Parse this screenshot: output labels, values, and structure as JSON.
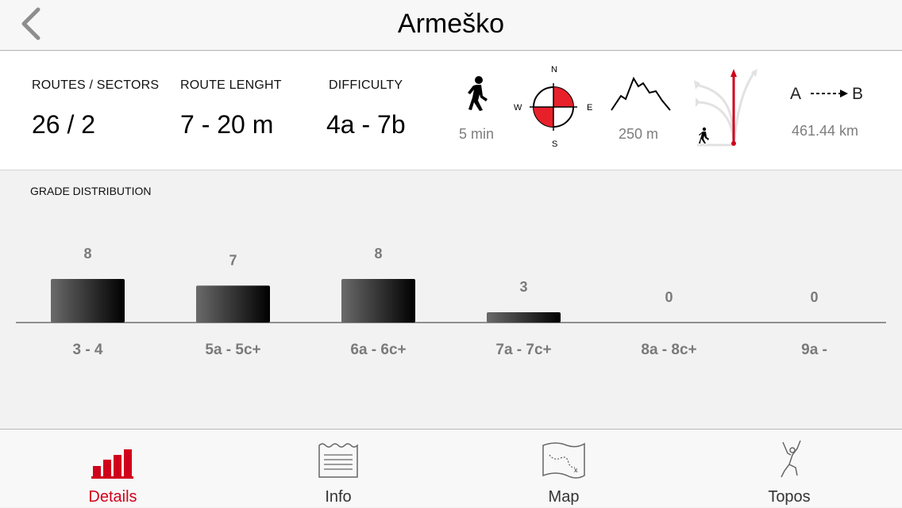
{
  "header": {
    "title": "Armeško"
  },
  "stats": {
    "routes_label": "ROUTES / SECTORS",
    "routes_value": "26 / 2",
    "length_label": "ROUTE LENGHT",
    "length_value": "7 - 20 m",
    "difficulty_label": "DIFFICULTY",
    "difficulty_value": "4a - 7b",
    "approach_time": "5 min",
    "compass": {
      "n": "N",
      "s": "S",
      "e": "E",
      "w": "W"
    },
    "altitude": "250 m",
    "distance_a": "A",
    "distance_b": "B",
    "distance_value": "461.44 km"
  },
  "grade_distribution": {
    "title": "GRADE DISTRIBUTION"
  },
  "chart_data": {
    "type": "bar",
    "categories": [
      "3 - 4",
      "5a - 5c+",
      "6a - 6c+",
      "7a - 7c+",
      "8a - 8c+",
      "9a -"
    ],
    "values": [
      8,
      7,
      8,
      3,
      0,
      0
    ],
    "ylim": [
      0,
      8
    ]
  },
  "tabbar": {
    "tabs": [
      {
        "label": "Details",
        "icon": "bar-chart-icon",
        "active": true
      },
      {
        "label": "Info",
        "icon": "document-icon",
        "active": false
      },
      {
        "label": "Map",
        "icon": "map-icon",
        "active": false
      },
      {
        "label": "Topos",
        "icon": "climber-icon",
        "active": false
      }
    ]
  },
  "colors": {
    "accent": "#d0021b",
    "bar_dark": "#000000",
    "bar_light": "#6a6a6a"
  }
}
